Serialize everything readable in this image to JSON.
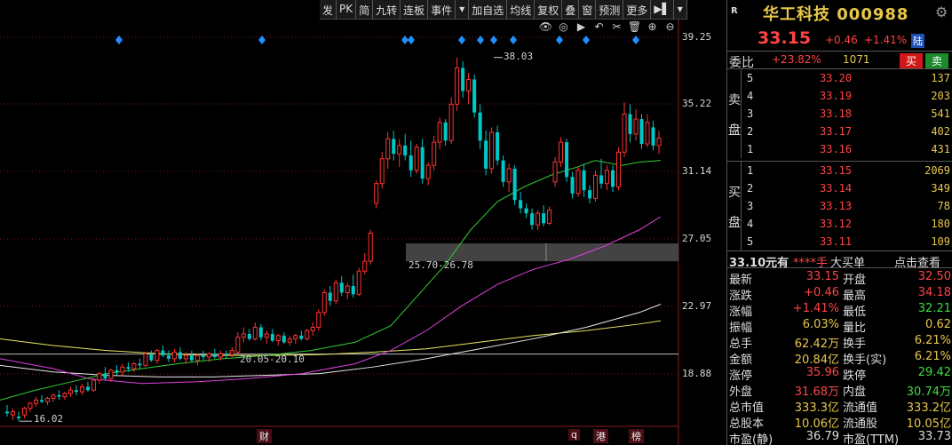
{
  "toolbar": {
    "items": [
      "发",
      "PK",
      "简",
      "九转",
      "连板",
      "事件",
      "▾",
      "加自选",
      "均线",
      "复权",
      "叠",
      "窗",
      "预测",
      "更多",
      "▶▌",
      "▾"
    ]
  },
  "chart_icons": [
    "eye-icon",
    "circle-play-icon",
    "play-icon",
    "undo-icon",
    "scissors-icon",
    "trash-icon",
    "zoom-in-icon",
    "zoom-out-icon"
  ],
  "chart_icon_glyphs": [
    "👁",
    "◎",
    "▶",
    "↶",
    "✂",
    "🗑",
    "⊕",
    "⊖"
  ],
  "chart_data": {
    "type": "candlestick",
    "price_axis_ticks": [
      "39.25",
      "35.22",
      "31.14",
      "27.05",
      "22.97",
      "18.88"
    ],
    "ylim": [
      15.5,
      40.5
    ],
    "annotations": {
      "high_label": "38.03",
      "low_label": "16.02",
      "gap_zone_label": "25.70-26.78",
      "gap_zone": [
        25.7,
        26.78
      ],
      "line_label": "20.05-20.10",
      "line_level": 20.08
    },
    "bottom_markers": [
      "财",
      "q",
      "港",
      "榜"
    ],
    "colors": {
      "up": "#ff3232",
      "down": "#00c8c8",
      "ma_green": "#33cc33",
      "ma_magenta": "#e040e0",
      "ma_white": "#e8e8e8",
      "ma_yellow": "#e8e860",
      "marker": "#1e90ff"
    },
    "candles": [
      {
        "o": 16.6,
        "h": 17.0,
        "l": 16.3,
        "c": 16.5
      },
      {
        "o": 16.4,
        "h": 16.8,
        "l": 16.1,
        "c": 16.6
      },
      {
        "o": 16.3,
        "h": 16.6,
        "l": 16.02,
        "c": 16.2
      },
      {
        "o": 16.4,
        "h": 16.9,
        "l": 16.2,
        "c": 16.8
      },
      {
        "o": 16.8,
        "h": 17.2,
        "l": 16.6,
        "c": 17.1
      },
      {
        "o": 17.1,
        "h": 17.5,
        "l": 16.9,
        "c": 17.3
      },
      {
        "o": 17.3,
        "h": 17.6,
        "l": 17.1,
        "c": 17.2
      },
      {
        "o": 17.2,
        "h": 17.5,
        "l": 17.0,
        "c": 17.4
      },
      {
        "o": 17.4,
        "h": 17.7,
        "l": 17.2,
        "c": 17.6
      },
      {
        "o": 17.6,
        "h": 17.9,
        "l": 17.3,
        "c": 17.5
      },
      {
        "o": 17.5,
        "h": 17.8,
        "l": 17.3,
        "c": 17.7
      },
      {
        "o": 17.7,
        "h": 18.1,
        "l": 17.5,
        "c": 17.9
      },
      {
        "o": 17.9,
        "h": 18.2,
        "l": 17.6,
        "c": 17.8
      },
      {
        "o": 17.8,
        "h": 18.3,
        "l": 17.6,
        "c": 18.1
      },
      {
        "o": 18.1,
        "h": 18.4,
        "l": 17.8,
        "c": 17.9
      },
      {
        "o": 17.9,
        "h": 18.6,
        "l": 17.8,
        "c": 18.5
      },
      {
        "o": 18.5,
        "h": 19.0,
        "l": 18.3,
        "c": 18.9
      },
      {
        "o": 18.9,
        "h": 19.3,
        "l": 18.5,
        "c": 18.6
      },
      {
        "o": 18.6,
        "h": 19.2,
        "l": 18.4,
        "c": 19.1
      },
      {
        "o": 19.1,
        "h": 19.4,
        "l": 18.8,
        "c": 19.0
      },
      {
        "o": 19.0,
        "h": 19.5,
        "l": 18.8,
        "c": 19.3
      },
      {
        "o": 19.3,
        "h": 19.6,
        "l": 19.0,
        "c": 19.2
      },
      {
        "o": 19.2,
        "h": 19.6,
        "l": 19.0,
        "c": 19.5
      },
      {
        "o": 19.5,
        "h": 19.8,
        "l": 19.2,
        "c": 19.4
      },
      {
        "o": 19.4,
        "h": 20.2,
        "l": 19.3,
        "c": 20.1
      },
      {
        "o": 20.1,
        "h": 20.3,
        "l": 19.6,
        "c": 19.7
      },
      {
        "o": 19.7,
        "h": 20.4,
        "l": 19.5,
        "c": 20.3
      },
      {
        "o": 20.3,
        "h": 20.6,
        "l": 19.9,
        "c": 20.0
      },
      {
        "o": 20.0,
        "h": 20.3,
        "l": 19.6,
        "c": 19.8
      },
      {
        "o": 19.8,
        "h": 20.4,
        "l": 19.6,
        "c": 20.2
      },
      {
        "o": 20.2,
        "h": 20.5,
        "l": 19.7,
        "c": 19.8
      },
      {
        "o": 19.8,
        "h": 20.2,
        "l": 19.5,
        "c": 20.0
      },
      {
        "o": 20.0,
        "h": 20.3,
        "l": 19.6,
        "c": 19.7
      },
      {
        "o": 19.7,
        "h": 20.1,
        "l": 19.4,
        "c": 20.0
      },
      {
        "o": 20.0,
        "h": 20.3,
        "l": 19.7,
        "c": 19.9
      },
      {
        "o": 19.9,
        "h": 20.2,
        "l": 19.6,
        "c": 20.1
      },
      {
        "o": 20.1,
        "h": 20.4,
        "l": 19.8,
        "c": 19.9
      },
      {
        "o": 19.9,
        "h": 20.3,
        "l": 19.7,
        "c": 20.1
      },
      {
        "o": 20.1,
        "h": 20.3,
        "l": 19.8,
        "c": 20.05
      },
      {
        "o": 20.05,
        "h": 20.5,
        "l": 19.9,
        "c": 20.3
      },
      {
        "o": 20.2,
        "h": 21.4,
        "l": 20.1,
        "c": 21.1
      },
      {
        "o": 21.1,
        "h": 21.7,
        "l": 20.8,
        "c": 21.3
      },
      {
        "o": 21.3,
        "h": 21.6,
        "l": 20.9,
        "c": 21.0
      },
      {
        "o": 21.0,
        "h": 22.0,
        "l": 20.9,
        "c": 21.7
      },
      {
        "o": 21.7,
        "h": 21.9,
        "l": 20.9,
        "c": 21.1
      },
      {
        "o": 21.1,
        "h": 21.5,
        "l": 20.7,
        "c": 21.3
      },
      {
        "o": 21.3,
        "h": 21.6,
        "l": 20.8,
        "c": 20.9
      },
      {
        "o": 20.9,
        "h": 21.3,
        "l": 20.6,
        "c": 21.2
      },
      {
        "o": 21.2,
        "h": 21.4,
        "l": 20.7,
        "c": 20.8
      },
      {
        "o": 20.8,
        "h": 21.2,
        "l": 20.6,
        "c": 21.0
      },
      {
        "o": 21.0,
        "h": 21.3,
        "l": 20.7,
        "c": 21.2
      },
      {
        "o": 21.2,
        "h": 21.5,
        "l": 20.9,
        "c": 21.0
      },
      {
        "o": 21.0,
        "h": 21.6,
        "l": 20.9,
        "c": 21.5
      },
      {
        "o": 21.5,
        "h": 22.0,
        "l": 21.2,
        "c": 21.7
      },
      {
        "o": 21.7,
        "h": 22.8,
        "l": 21.5,
        "c": 22.6
      },
      {
        "o": 22.6,
        "h": 24.0,
        "l": 22.4,
        "c": 23.8
      },
      {
        "o": 23.8,
        "h": 24.2,
        "l": 23.0,
        "c": 23.3
      },
      {
        "o": 23.3,
        "h": 24.6,
        "l": 23.1,
        "c": 24.4
      },
      {
        "o": 24.4,
        "h": 24.8,
        "l": 23.6,
        "c": 23.8
      },
      {
        "o": 23.8,
        "h": 24.4,
        "l": 23.4,
        "c": 24.2
      },
      {
        "o": 24.2,
        "h": 24.9,
        "l": 23.5,
        "c": 23.7
      },
      {
        "o": 23.7,
        "h": 25.3,
        "l": 23.6,
        "c": 25.1
      },
      {
        "o": 25.1,
        "h": 26.2,
        "l": 24.9,
        "c": 25.7
      },
      {
        "o": 25.7,
        "h": 27.6,
        "l": 25.5,
        "c": 27.4
      },
      {
        "o": 29.2,
        "h": 30.6,
        "l": 28.9,
        "c": 30.4
      },
      {
        "o": 30.4,
        "h": 32.3,
        "l": 30.1,
        "c": 31.9
      },
      {
        "o": 31.9,
        "h": 33.5,
        "l": 31.3,
        "c": 33.1
      },
      {
        "o": 33.1,
        "h": 33.6,
        "l": 31.8,
        "c": 32.2
      },
      {
        "o": 32.2,
        "h": 33.1,
        "l": 31.4,
        "c": 32.7
      },
      {
        "o": 32.7,
        "h": 33.4,
        "l": 31.8,
        "c": 32.1
      },
      {
        "o": 32.1,
        "h": 33.0,
        "l": 30.8,
        "c": 31.2
      },
      {
        "o": 31.2,
        "h": 32.8,
        "l": 31.0,
        "c": 32.6
      },
      {
        "o": 32.6,
        "h": 33.1,
        "l": 30.4,
        "c": 30.7
      },
      {
        "o": 30.7,
        "h": 31.7,
        "l": 30.3,
        "c": 31.5
      },
      {
        "o": 31.5,
        "h": 33.3,
        "l": 31.2,
        "c": 32.9
      },
      {
        "o": 32.9,
        "h": 34.4,
        "l": 32.5,
        "c": 34.1
      },
      {
        "o": 34.1,
        "h": 34.3,
        "l": 32.7,
        "c": 33.0
      },
      {
        "o": 33.0,
        "h": 35.6,
        "l": 32.8,
        "c": 35.2
      },
      {
        "o": 35.2,
        "h": 38.03,
        "l": 34.8,
        "c": 37.4
      },
      {
        "o": 37.4,
        "h": 37.8,
        "l": 35.6,
        "c": 36.0
      },
      {
        "o": 36.0,
        "h": 37.1,
        "l": 35.2,
        "c": 36.7
      },
      {
        "o": 36.7,
        "h": 37.0,
        "l": 34.4,
        "c": 34.7
      },
      {
        "o": 34.7,
        "h": 35.2,
        "l": 32.5,
        "c": 33.0
      },
      {
        "o": 33.0,
        "h": 33.6,
        "l": 30.9,
        "c": 31.3
      },
      {
        "o": 31.3,
        "h": 33.8,
        "l": 31.0,
        "c": 33.5
      },
      {
        "o": 33.5,
        "h": 33.9,
        "l": 31.5,
        "c": 31.8
      },
      {
        "o": 31.8,
        "h": 32.1,
        "l": 30.2,
        "c": 30.5
      },
      {
        "o": 30.5,
        "h": 31.6,
        "l": 29.9,
        "c": 31.3
      },
      {
        "o": 31.3,
        "h": 31.5,
        "l": 29.1,
        "c": 29.4
      },
      {
        "o": 29.4,
        "h": 29.9,
        "l": 28.6,
        "c": 28.9
      },
      {
        "o": 28.9,
        "h": 29.2,
        "l": 28.3,
        "c": 28.6
      },
      {
        "o": 28.6,
        "h": 28.9,
        "l": 27.6,
        "c": 27.9
      },
      {
        "o": 27.9,
        "h": 28.8,
        "l": 27.6,
        "c": 28.6
      },
      {
        "o": 28.6,
        "h": 29.1,
        "l": 27.8,
        "c": 28.0
      },
      {
        "o": 28.0,
        "h": 29.0,
        "l": 27.9,
        "c": 28.8
      },
      {
        "o": 30.5,
        "h": 32.0,
        "l": 30.2,
        "c": 31.7
      },
      {
        "o": 31.7,
        "h": 33.2,
        "l": 31.4,
        "c": 32.9
      },
      {
        "o": 32.9,
        "h": 33.1,
        "l": 30.5,
        "c": 30.8
      },
      {
        "o": 30.8,
        "h": 31.1,
        "l": 29.5,
        "c": 29.8
      },
      {
        "o": 29.8,
        "h": 31.4,
        "l": 29.6,
        "c": 31.2
      },
      {
        "o": 31.2,
        "h": 31.6,
        "l": 29.6,
        "c": 30.0
      },
      {
        "o": 30.0,
        "h": 30.3,
        "l": 29.2,
        "c": 29.5
      },
      {
        "o": 29.5,
        "h": 31.2,
        "l": 29.3,
        "c": 30.9
      },
      {
        "o": 30.9,
        "h": 31.9,
        "l": 30.1,
        "c": 30.4
      },
      {
        "o": 30.4,
        "h": 31.5,
        "l": 30.0,
        "c": 31.2
      },
      {
        "o": 31.2,
        "h": 31.5,
        "l": 29.9,
        "c": 30.2
      },
      {
        "o": 30.2,
        "h": 32.6,
        "l": 30.0,
        "c": 32.3
      },
      {
        "o": 32.3,
        "h": 35.3,
        "l": 32.0,
        "c": 34.6
      },
      {
        "o": 34.6,
        "h": 35.2,
        "l": 32.9,
        "c": 33.4
      },
      {
        "o": 33.4,
        "h": 34.9,
        "l": 33.0,
        "c": 34.3
      },
      {
        "o": 34.3,
        "h": 34.6,
        "l": 32.5,
        "c": 32.8
      },
      {
        "o": 32.8,
        "h": 34.6,
        "l": 32.6,
        "c": 34.1
      },
      {
        "o": 33.8,
        "h": 34.2,
        "l": 32.4,
        "c": 32.7
      },
      {
        "o": 32.7,
        "h": 33.6,
        "l": 32.2,
        "c": 33.15
      }
    ],
    "ma_green": [
      [
        0,
        17.3
      ],
      [
        40,
        17.9
      ],
      [
        80,
        18.4
      ],
      [
        120,
        18.9
      ],
      [
        160,
        19.2
      ],
      [
        200,
        19.5
      ],
      [
        250,
        19.8
      ],
      [
        300,
        20.0
      ],
      [
        350,
        20.3
      ],
      [
        400,
        20.8
      ],
      [
        440,
        21.8
      ],
      [
        470,
        23.6
      ],
      [
        500,
        25.4
      ],
      [
        530,
        27.6
      ],
      [
        560,
        29.3
      ],
      [
        590,
        30.2
      ],
      [
        620,
        30.9
      ],
      [
        650,
        31.4
      ],
      [
        670,
        31.8
      ],
      [
        700,
        31.5
      ],
      [
        720,
        31.7
      ],
      [
        744,
        31.8
      ]
    ],
    "ma_magenta": [
      [
        0,
        19.8
      ],
      [
        60,
        19.2
      ],
      [
        100,
        18.6
      ],
      [
        160,
        18.3
      ],
      [
        220,
        18.4
      ],
      [
        280,
        18.6
      ],
      [
        340,
        18.9
      ],
      [
        400,
        19.5
      ],
      [
        440,
        20.3
      ],
      [
        480,
        21.5
      ],
      [
        520,
        23.0
      ],
      [
        560,
        24.3
      ],
      [
        600,
        25.2
      ],
      [
        640,
        25.8
      ],
      [
        680,
        26.6
      ],
      [
        720,
        27.6
      ],
      [
        744,
        28.4
      ]
    ],
    "ma_white": [
      [
        0,
        19.4
      ],
      [
        60,
        19.0
      ],
      [
        120,
        18.8
      ],
      [
        180,
        18.7
      ],
      [
        240,
        18.7
      ],
      [
        300,
        18.8
      ],
      [
        360,
        18.9
      ],
      [
        420,
        19.3
      ],
      [
        480,
        19.8
      ],
      [
        540,
        20.4
      ],
      [
        600,
        21.0
      ],
      [
        660,
        21.7
      ],
      [
        720,
        22.6
      ],
      [
        744,
        23.1
      ]
    ],
    "ma_yellow": [
      [
        0,
        21.0
      ],
      [
        60,
        20.6
      ],
      [
        120,
        20.3
      ],
      [
        180,
        20.1
      ],
      [
        240,
        20.0
      ],
      [
        300,
        20.0
      ],
      [
        360,
        20.05
      ],
      [
        420,
        20.2
      ],
      [
        480,
        20.4
      ],
      [
        540,
        20.8
      ],
      [
        600,
        21.2
      ],
      [
        660,
        21.5
      ],
      [
        720,
        21.9
      ],
      [
        744,
        22.1
      ]
    ],
    "markers": [
      134,
      295,
      456,
      463,
      520,
      541,
      556,
      578,
      630,
      660,
      716
    ],
    "gridlines": [
      39.25,
      35.22,
      31.14,
      27.05,
      22.97,
      18.88
    ]
  },
  "stock": {
    "tag": "R",
    "name": "华工科技 000988",
    "price": "33.15",
    "change": "+0.46",
    "change_pct": "+1.41%",
    "market": "陆"
  },
  "weibi": {
    "label": "委比",
    "ratio": "+23.82%",
    "diff": "1071",
    "sell_btn": "卖",
    "buy_btn": "买"
  },
  "asks_label": [
    "卖",
    "盘"
  ],
  "bids_label": [
    "买",
    "盘"
  ],
  "asks": [
    {
      "level": "5",
      "price": "33.20",
      "vol": "137"
    },
    {
      "level": "4",
      "price": "33.19",
      "vol": "203"
    },
    {
      "level": "3",
      "price": "33.18",
      "vol": "541"
    },
    {
      "level": "2",
      "price": "33.17",
      "vol": "402"
    },
    {
      "level": "1",
      "price": "33.16",
      "vol": "431"
    }
  ],
  "bids": [
    {
      "level": "1",
      "price": "33.15",
      "vol": "2069"
    },
    {
      "level": "2",
      "price": "33.14",
      "vol": "349"
    },
    {
      "level": "3",
      "price": "33.13",
      "vol": "78"
    },
    {
      "level": "4",
      "price": "33.12",
      "vol": "180"
    },
    {
      "level": "5",
      "price": "33.11",
      "vol": "109"
    }
  ],
  "big_order": {
    "price": "33.10元有",
    "qty": "****手",
    "type": "大买单",
    "link": "点击查看"
  },
  "stats": [
    [
      "最新",
      "33.15",
      "red",
      "开盘",
      "32.50",
      "red"
    ],
    [
      "涨跌",
      "+0.46",
      "red",
      "最高",
      "34.18",
      "red"
    ],
    [
      "涨幅",
      "+1.41%",
      "red",
      "最低",
      "32.21",
      "grn"
    ],
    [
      "振幅",
      "6.03%",
      "yel",
      "量比",
      "0.62",
      "yel"
    ],
    [
      "总手",
      "62.42万",
      "yel",
      "换手",
      "6.21%",
      "yel"
    ],
    [
      "金额",
      "20.84亿",
      "yel",
      "换手(实)",
      "6.21%",
      "yel"
    ],
    [
      "涨停",
      "35.96",
      "red",
      "跌停",
      "29.42",
      "grn"
    ],
    [
      "外盘",
      "31.68万",
      "red",
      "内盘",
      "30.74万",
      "grn"
    ],
    [
      "总市值",
      "333.3亿",
      "yel",
      "流通值",
      "333.2亿",
      "yel"
    ],
    [
      "总股本",
      "10.06亿",
      "yel",
      "流通股",
      "10.05亿",
      "yel"
    ],
    [
      "市盈(静)",
      "36.79",
      "lab",
      "市盈(TTM)",
      "33.73",
      "lab"
    ]
  ]
}
